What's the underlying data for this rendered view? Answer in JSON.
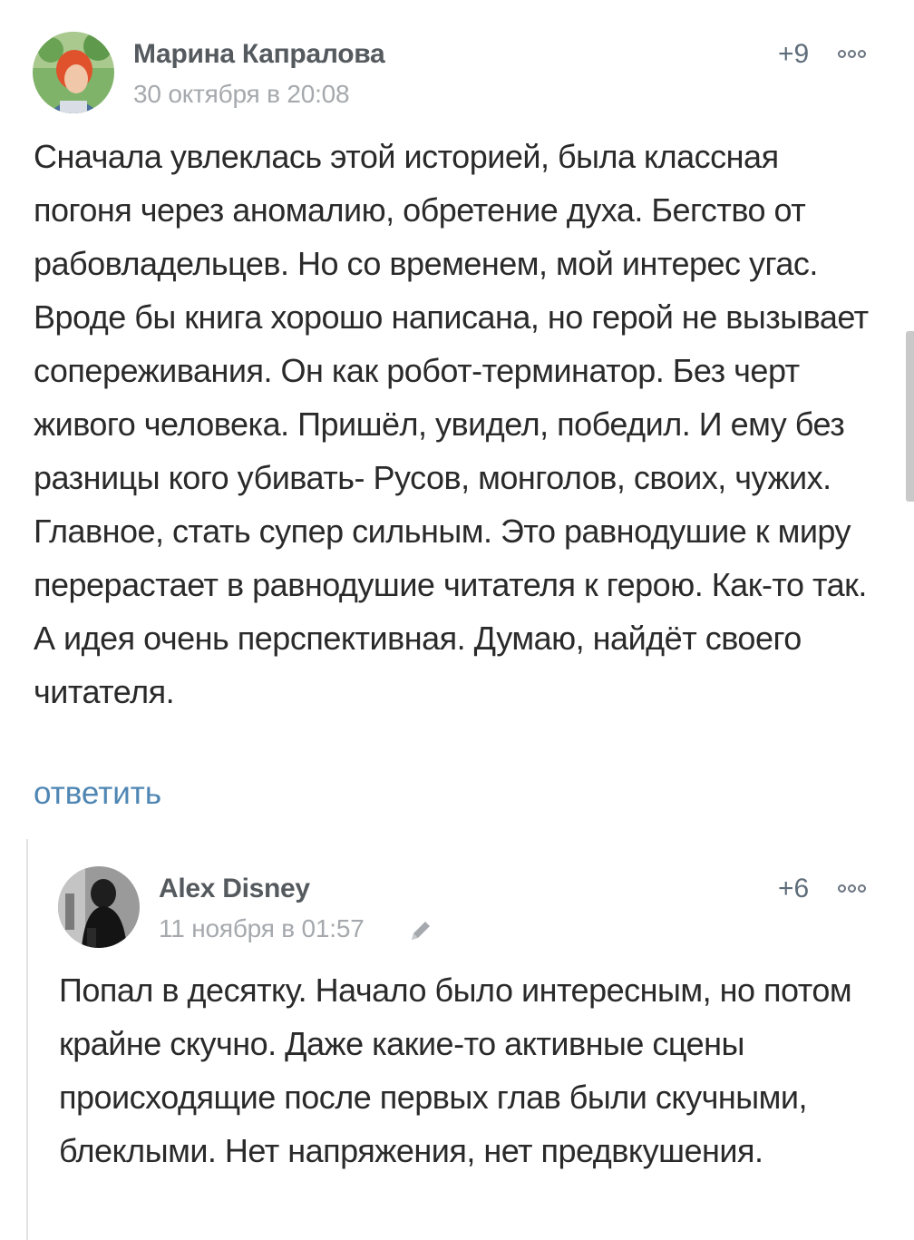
{
  "comments": [
    {
      "author": "Марина Капралова",
      "date": "30 октября в 20:08",
      "rating": "+9",
      "text": "Сначала увлеклась этой историей, была классная погоня через аномалию, обретение духа. Бегство от рабовладельцев. Но со временем, мой интерес угас. Вроде бы книга хорошо написана, но герой не вызывает сопереживания. Он как робот-терминатор. Без черт живого человека. Пришёл, увидел, победил. И ему без разницы кого убивать- Русов, монголов, своих, чужих. Главное, стать супер сильным. Это равнодушие к миру перерастает в равнодушие читателя к герою. Как-то так. А идея очень перспективная. Думаю, найдёт своего читателя.",
      "reply_label": "ответить",
      "avatar_icon": "user-photo-avatar",
      "more_icon": "more-options-icon"
    },
    {
      "author": "Alex Disney",
      "date": "11 ноября в 01:57",
      "rating": "+6",
      "text": "Попал в десятку. Начало было интересным, но потом крайне скучно. Даже какие-то активные сцены происходящие после первых глав были скучными, блеклыми. Нет напряжения, нет предвкушения.",
      "avatar_icon": "user-photo-avatar",
      "edit_icon": "pencil-icon",
      "more_icon": "more-options-icon"
    }
  ],
  "colors": {
    "author": "#555a5f",
    "date": "#a5a9ad",
    "text": "#2a2a2a",
    "link": "#4f86b3",
    "rating": "#5f6d7a"
  }
}
